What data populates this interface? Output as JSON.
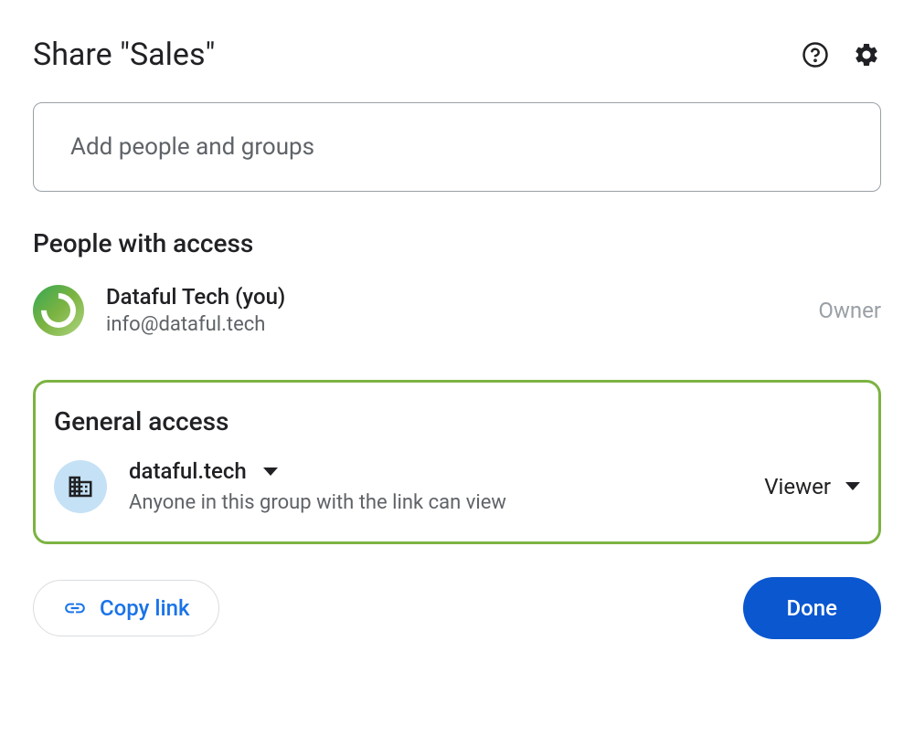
{
  "header": {
    "title": "Share \"Sales\""
  },
  "input": {
    "placeholder": "Add people and groups"
  },
  "sections": {
    "people_with_access": "People with access",
    "general_access": "General access"
  },
  "people": [
    {
      "name": "Dataful Tech (you)",
      "email": "info@dataful.tech",
      "role": "Owner"
    }
  ],
  "general_access": {
    "scope": "dataful.tech",
    "description": "Anyone in this group with the link can view",
    "permission": "Viewer"
  },
  "buttons": {
    "copy_link": "Copy link",
    "done": "Done"
  },
  "icons": {
    "help": "help-icon",
    "settings": "gear-icon",
    "link": "link-icon",
    "building": "building-icon"
  }
}
